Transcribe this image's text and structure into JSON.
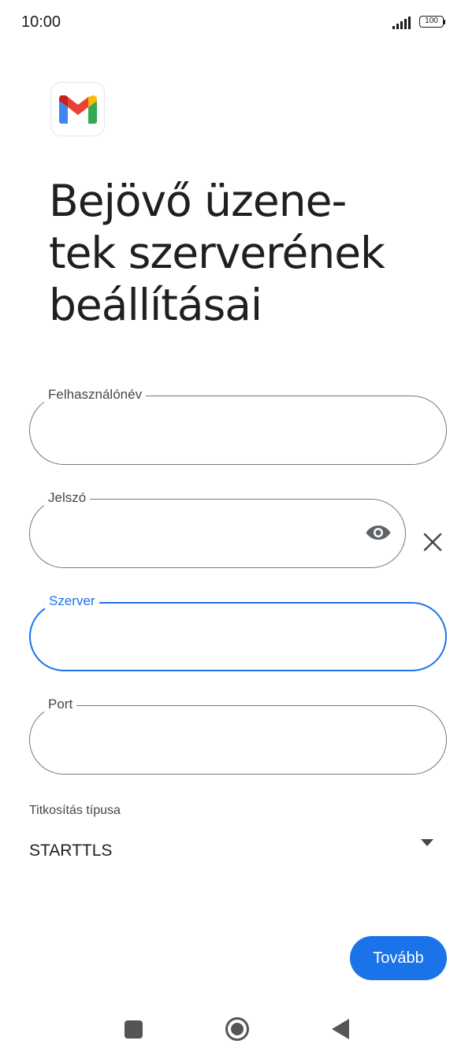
{
  "status_bar": {
    "time": "10:00",
    "battery": "100"
  },
  "app": {
    "logo_icon": "gmail-logo-icon"
  },
  "page": {
    "title": "Bejövő üzene-\ntek szerverének\nbeállításai"
  },
  "form": {
    "username": {
      "label": "Felhasználónév",
      "value": ""
    },
    "password": {
      "label": "Jelszó",
      "value": "",
      "toggle_icon": "eye-icon",
      "clear_icon": "close-icon"
    },
    "server": {
      "label": "Szerver",
      "value": ""
    },
    "port": {
      "label": "Port",
      "value": ""
    },
    "encryption": {
      "label": "Titkosítás típusa",
      "selected": "STARTTLS"
    }
  },
  "actions": {
    "next_label": "Tovább"
  },
  "colors": {
    "accent": "#1a73e8",
    "outline": "#747775",
    "text": "#1f1f1f"
  },
  "nav_bar": {
    "recents_icon": "square-icon",
    "home_icon": "circle-home-icon",
    "back_icon": "triangle-back-icon"
  }
}
